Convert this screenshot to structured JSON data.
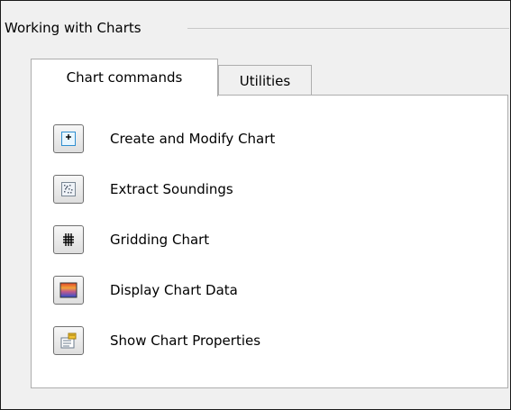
{
  "group": {
    "title": "Working with Charts"
  },
  "tabs": [
    {
      "label": "Chart commands",
      "active": true
    },
    {
      "label": "Utilities",
      "active": false
    }
  ],
  "commands": [
    {
      "label": "Create and Modify Chart",
      "icon": "create-chart-icon"
    },
    {
      "label": "Extract Soundings",
      "icon": "soundings-icon"
    },
    {
      "label": "Gridding Chart",
      "icon": "grid-icon"
    },
    {
      "label": "Display Chart Data",
      "icon": "chart-data-icon"
    },
    {
      "label": "Show Chart Properties",
      "icon": "properties-icon"
    }
  ]
}
